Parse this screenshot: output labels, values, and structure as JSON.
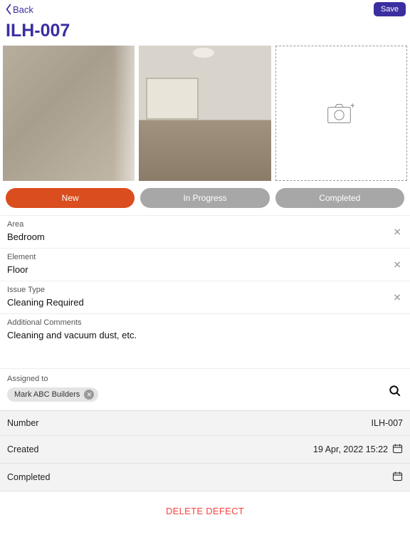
{
  "nav": {
    "back": "Back",
    "save": "Save"
  },
  "title": "ILH-007",
  "addPhotoAlt": "add-photo",
  "status": {
    "new": "New",
    "inProgress": "In Progress",
    "completed": "Completed"
  },
  "fields": {
    "areaLabel": "Area",
    "areaValue": "Bedroom",
    "elementLabel": "Element",
    "elementValue": "Floor",
    "issueLabel": "Issue Type",
    "issueValue": "Cleaning Required",
    "commentsLabel": "Additional Comments",
    "commentsValue": "Cleaning and vacuum dust, etc."
  },
  "assigned": {
    "label": "Assigned to",
    "chip": "Mark ABC Builders"
  },
  "meta": {
    "numberLabel": "Number",
    "numberValue": "ILH-007",
    "createdLabel": "Created",
    "createdValue": "19 Apr, 2022 15:22",
    "completedLabel": "Completed",
    "completedValue": ""
  },
  "deleteLabel": "DELETE DEFECT"
}
